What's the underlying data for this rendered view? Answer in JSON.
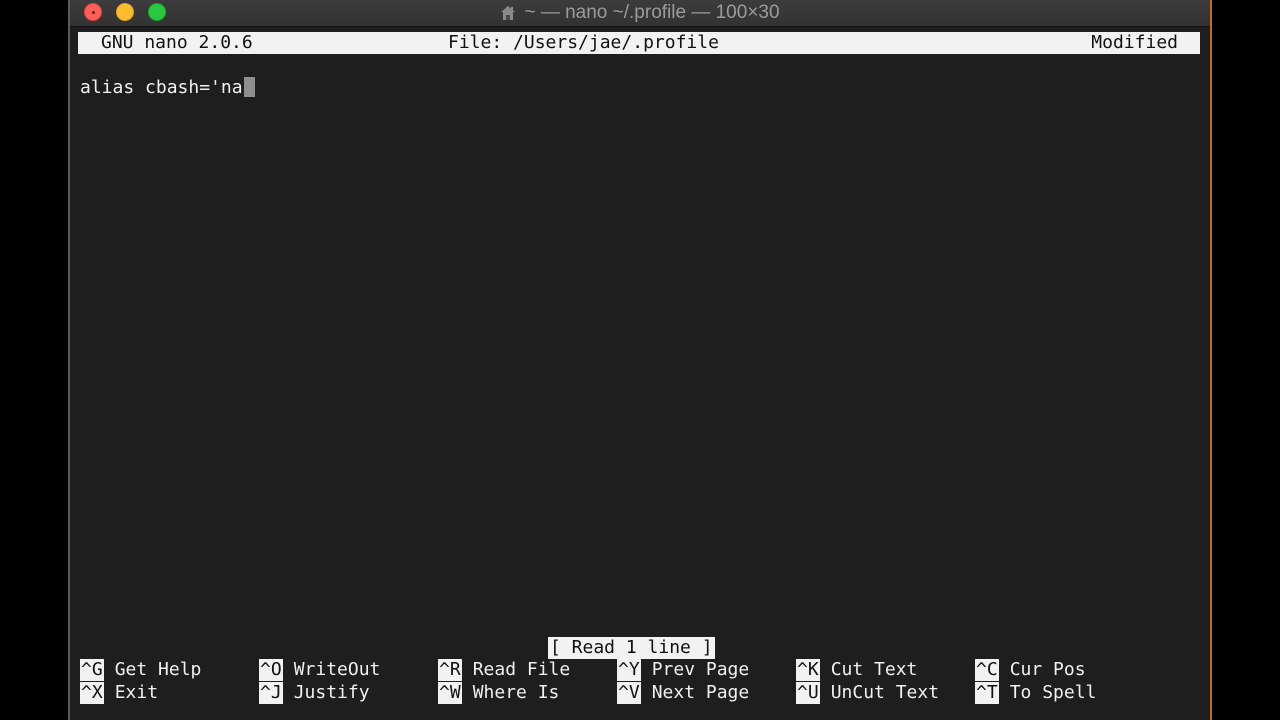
{
  "window": {
    "title": "~ — nano ~/.profile — 100×30"
  },
  "nano": {
    "version": "GNU nano 2.0.6",
    "file": "File: /Users/jae/.profile",
    "state": "Modified",
    "content_line": "alias cbash='na",
    "status_message": "[ Read 1 line ]"
  },
  "shortcuts": [
    {
      "key": "^G",
      "label": "Get Help"
    },
    {
      "key": "^X",
      "label": "Exit"
    },
    {
      "key": "^O",
      "label": "WriteOut"
    },
    {
      "key": "^J",
      "label": "Justify"
    },
    {
      "key": "^R",
      "label": "Read File"
    },
    {
      "key": "^W",
      "label": "Where Is"
    },
    {
      "key": "^Y",
      "label": "Prev Page"
    },
    {
      "key": "^V",
      "label": "Next Page"
    },
    {
      "key": "^K",
      "label": "Cut Text"
    },
    {
      "key": "^U",
      "label": "UnCut Text"
    },
    {
      "key": "^C",
      "label": "Cur Pos"
    },
    {
      "key": "^T",
      "label": "To Spell"
    }
  ],
  "colors": {
    "terminal_bg": "#1e1e1e",
    "inverse_bg": "#f2f2f2",
    "close": "#fe5f57",
    "minimize": "#febc2e",
    "maximize": "#28c840"
  }
}
